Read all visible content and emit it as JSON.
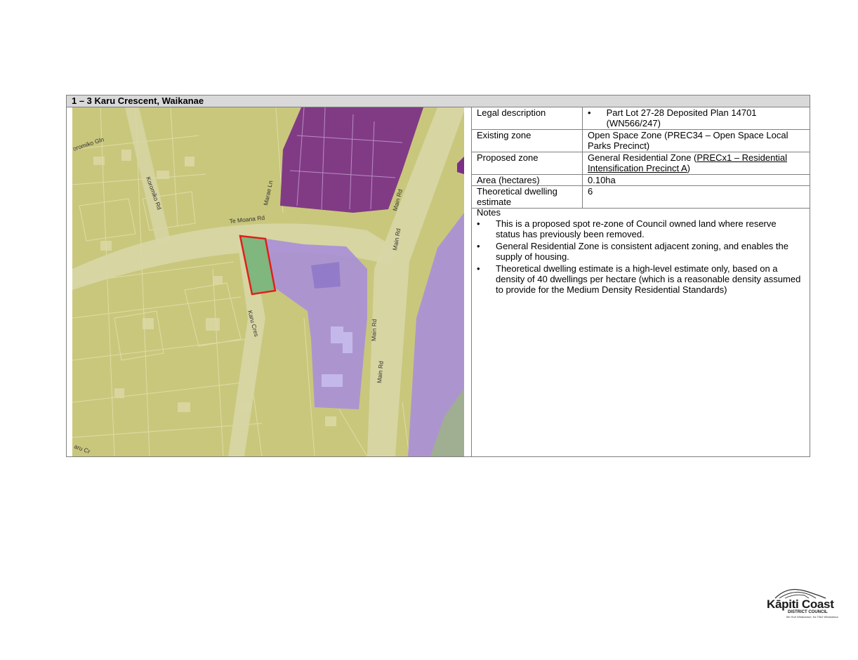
{
  "header": {
    "title": "1 – 3 Karu Crescent, Waikanae"
  },
  "map": {
    "street_labels": {
      "koromiko_gln": "oromiko Gln",
      "koromiko_rd": "Koromiko Rd",
      "marae_ln": "Marae Ln",
      "te_moana_rd": "Te Moana Rd",
      "main_rd_1": "Main Rd",
      "main_rd_2": "Main Rd",
      "main_rd_3": "Main Rd",
      "main_rd_4": "Main Rd",
      "karu_cres": "Karu Cres",
      "karu_cres_corner": "aru Cr"
    },
    "colors": {
      "residential": "#c9c77c",
      "town_centre": "#7b2f86",
      "mixed_use": "#a88fd8",
      "open_space": "#7fb77e",
      "site_outline": "#e0201b",
      "road": "#d8d6a6"
    }
  },
  "details": {
    "legal_label": "Legal description",
    "legal_value": "Part Lot 27-28 Deposited Plan 14701 (WN566/247)",
    "existing_label": "Existing zone",
    "existing_value": "Open Space Zone (PREC34 – Open Space Local Parks Precinct)",
    "proposed_label": "Proposed zone",
    "proposed_value_prefix": "General Residential Zone (",
    "proposed_value_underlined": "PRECx1 – Residential Intensification Precinct A",
    "proposed_value_suffix": ")",
    "area_label": "Area (hectares)",
    "area_value": "0.10ha",
    "dwelling_label": "Theoretical dwelling estimate",
    "dwelling_value": "6"
  },
  "notes": {
    "heading": "Notes",
    "items": [
      "This is a proposed spot re-zone of Council owned land where reserve status has previously been removed.",
      "General Residential Zone is consistent adjacent zoning, and enables the supply of housing.",
      "Theoretical dwelling estimate is a high-level estimate only, based on a density of 40 dwellings per hectare (which is a reasonable density assumed to provide for the Medium Density Residential Standards)"
    ]
  },
  "logo": {
    "name": "Kāpiti Coast",
    "sub": "DISTRICT COUNCIL",
    "tagline": "Me Huri Whakamuri, Ka Titiro Whakamua"
  }
}
